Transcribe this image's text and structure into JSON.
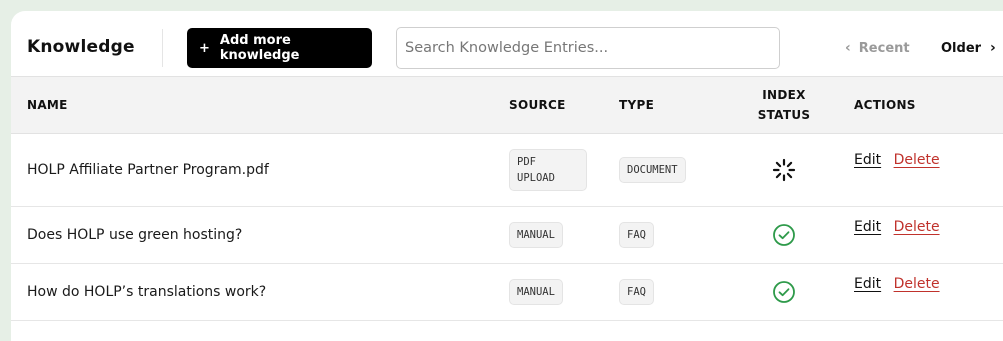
{
  "header": {
    "title": "Knowledge",
    "add_button_label": "Add more knowledge",
    "add_button_icon": "plus-icon",
    "search_placeholder": "Search Knowledge Entries...",
    "search_value": "",
    "pager_recent": "Recent",
    "pager_older": "Older"
  },
  "table": {
    "columns": {
      "name": "NAME",
      "source": "SOURCE",
      "type": "TYPE",
      "status_line1": "INDEX",
      "status_line2": "STATUS",
      "actions": "ACTIONS"
    },
    "rows": [
      {
        "name": "HOLP Affiliate Partner Program.pdf",
        "source_line1": "PDF",
        "source_line2": "UPLOAD",
        "type": "DOCUMENT",
        "status": "loading-spinner-icon",
        "edit": "Edit",
        "delete": "Delete"
      },
      {
        "name": "Does HOLP use green hosting?",
        "source": "MANUAL",
        "type": "FAQ",
        "status": "check-circle-icon",
        "edit": "Edit",
        "delete": "Delete"
      },
      {
        "name": "How do HOLP’s translations work?",
        "source": "MANUAL",
        "type": "FAQ",
        "status": "check-circle-icon",
        "edit": "Edit",
        "delete": "Delete"
      }
    ]
  },
  "colors": {
    "page_background": "#e6efe6",
    "primary_button": "#000000",
    "delete_link": "#c0322c",
    "success_check": "#2e9a4a",
    "muted_text": "#9a9a9a"
  }
}
